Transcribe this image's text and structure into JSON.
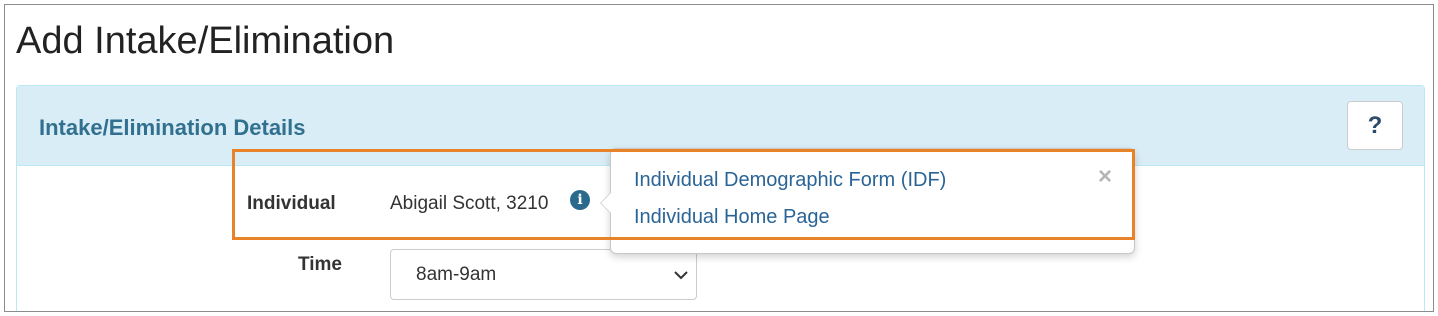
{
  "page": {
    "title": "Add Intake/Elimination"
  },
  "panel": {
    "title": "Intake/Elimination Details",
    "help_label": "?"
  },
  "form": {
    "individual_label": "Individual",
    "individual_value": "Abigail Scott, 3210",
    "info_icon": "i",
    "time_label": "Time",
    "time_value": "8am-9am"
  },
  "popover": {
    "links": [
      {
        "label": "Individual Demographic Form (IDF)"
      },
      {
        "label": "Individual Home Page"
      }
    ],
    "close_label": "×"
  },
  "colors": {
    "accent_highlight": "#e8832a",
    "panel_heading_bg": "#d9edf7",
    "panel_title": "#31708f",
    "link": "#2a6496",
    "info_icon": "#2a6a8c"
  },
  "icons": {
    "info": "info-circle-icon",
    "close": "close-icon",
    "dropdown": "chevron-down-icon",
    "help": "question-icon"
  }
}
